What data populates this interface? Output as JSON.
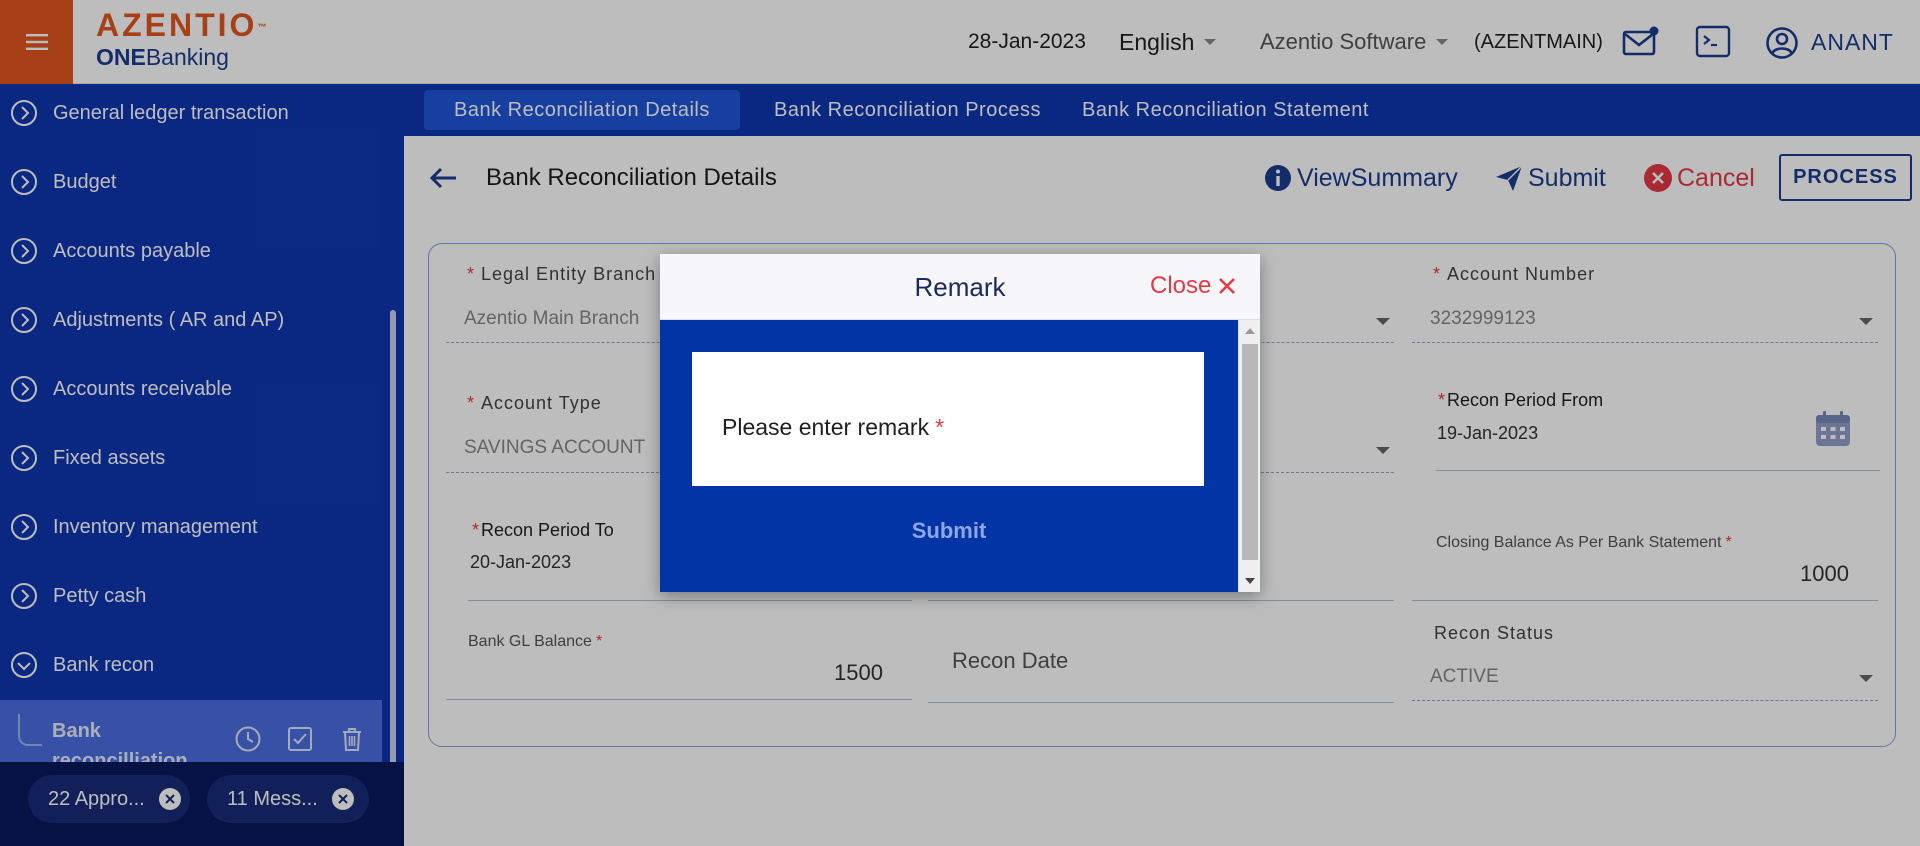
{
  "header": {
    "logo_main": "AZENTIO",
    "logo_tm": "™",
    "logo_sub_bold": "ONE",
    "logo_sub_rest": "Banking",
    "date": "28-Jan-2023",
    "language": "English",
    "company": "Azentio Software",
    "company_code": "(AZENTMAIN)",
    "user": "ANANT",
    "icons": [
      "menu-icon",
      "mail-icon",
      "terminal-icon",
      "user-icon"
    ]
  },
  "sidebar": {
    "items": [
      {
        "label": "General ledger transaction",
        "icon": "chevron-right-circle-icon"
      },
      {
        "label": "Budget",
        "icon": "chevron-right-circle-icon"
      },
      {
        "label": "Accounts payable",
        "icon": "chevron-right-circle-icon"
      },
      {
        "label": "Adjustments ( AR and AP)",
        "icon": "chevron-right-circle-icon"
      },
      {
        "label": "Accounts receivable",
        "icon": "chevron-right-circle-icon"
      },
      {
        "label": "Fixed assets",
        "icon": "chevron-right-circle-icon"
      },
      {
        "label": "Inventory management",
        "icon": "chevron-right-circle-icon"
      },
      {
        "label": "Petty cash",
        "icon": "chevron-right-circle-icon"
      },
      {
        "label": "Bank recon",
        "icon": "chevron-down-circle-icon"
      }
    ],
    "active_child": {
      "label": "Bank reconcilliation",
      "icons": [
        "history-icon",
        "checkbox-icon",
        "trash-icon"
      ]
    },
    "chips": [
      {
        "label": "22 Appro..."
      },
      {
        "label": "11 Mess..."
      }
    ]
  },
  "tabs": [
    {
      "label": "Bank Reconciliation Details",
      "active": true
    },
    {
      "label": "Bank Reconciliation Process",
      "active": false
    },
    {
      "label": "Bank Reconciliation Statement",
      "active": false
    }
  ],
  "page": {
    "title": "Bank Reconciliation Details",
    "actions": {
      "view_summary": "ViewSummary",
      "submit": "Submit",
      "cancel": "Cancel",
      "process": "PROCESS"
    }
  },
  "form": {
    "legal_entity_branch": {
      "label": "Legal Entity Branch",
      "value": "Azentio Main Branch"
    },
    "account_number": {
      "label": "Account Number",
      "value": "3232999123"
    },
    "account_type": {
      "label": "Account Type",
      "value": "SAVINGS ACCOUNT"
    },
    "recon_period_from": {
      "label": "Recon Period From",
      "value": "19-Jan-2023"
    },
    "recon_period_to": {
      "label": "Recon Period To",
      "value": "20-Jan-2023"
    },
    "closing_balance": {
      "label": "Closing Balance As Per Bank Statement",
      "value": "1000"
    },
    "bank_gl_balance": {
      "label": "Bank GL Balance",
      "value": "1500"
    },
    "recon_date": {
      "label": "Recon Date"
    },
    "recon_status": {
      "label": "Recon Status",
      "value": "ACTIVE"
    },
    "required_mark": "*"
  },
  "modal": {
    "title": "Remark",
    "close_label": "Close",
    "placeholder": "Please enter remark",
    "required_mark": "*",
    "submit_label": "Submit"
  },
  "colors": {
    "brand_orange": "#e2571f",
    "nav_blue": "#0e37b0",
    "footer_navy": "#07195c",
    "modal_blue": "#0234a6",
    "accent_blue": "#1b3d8f",
    "danger_red": "#e63946"
  }
}
